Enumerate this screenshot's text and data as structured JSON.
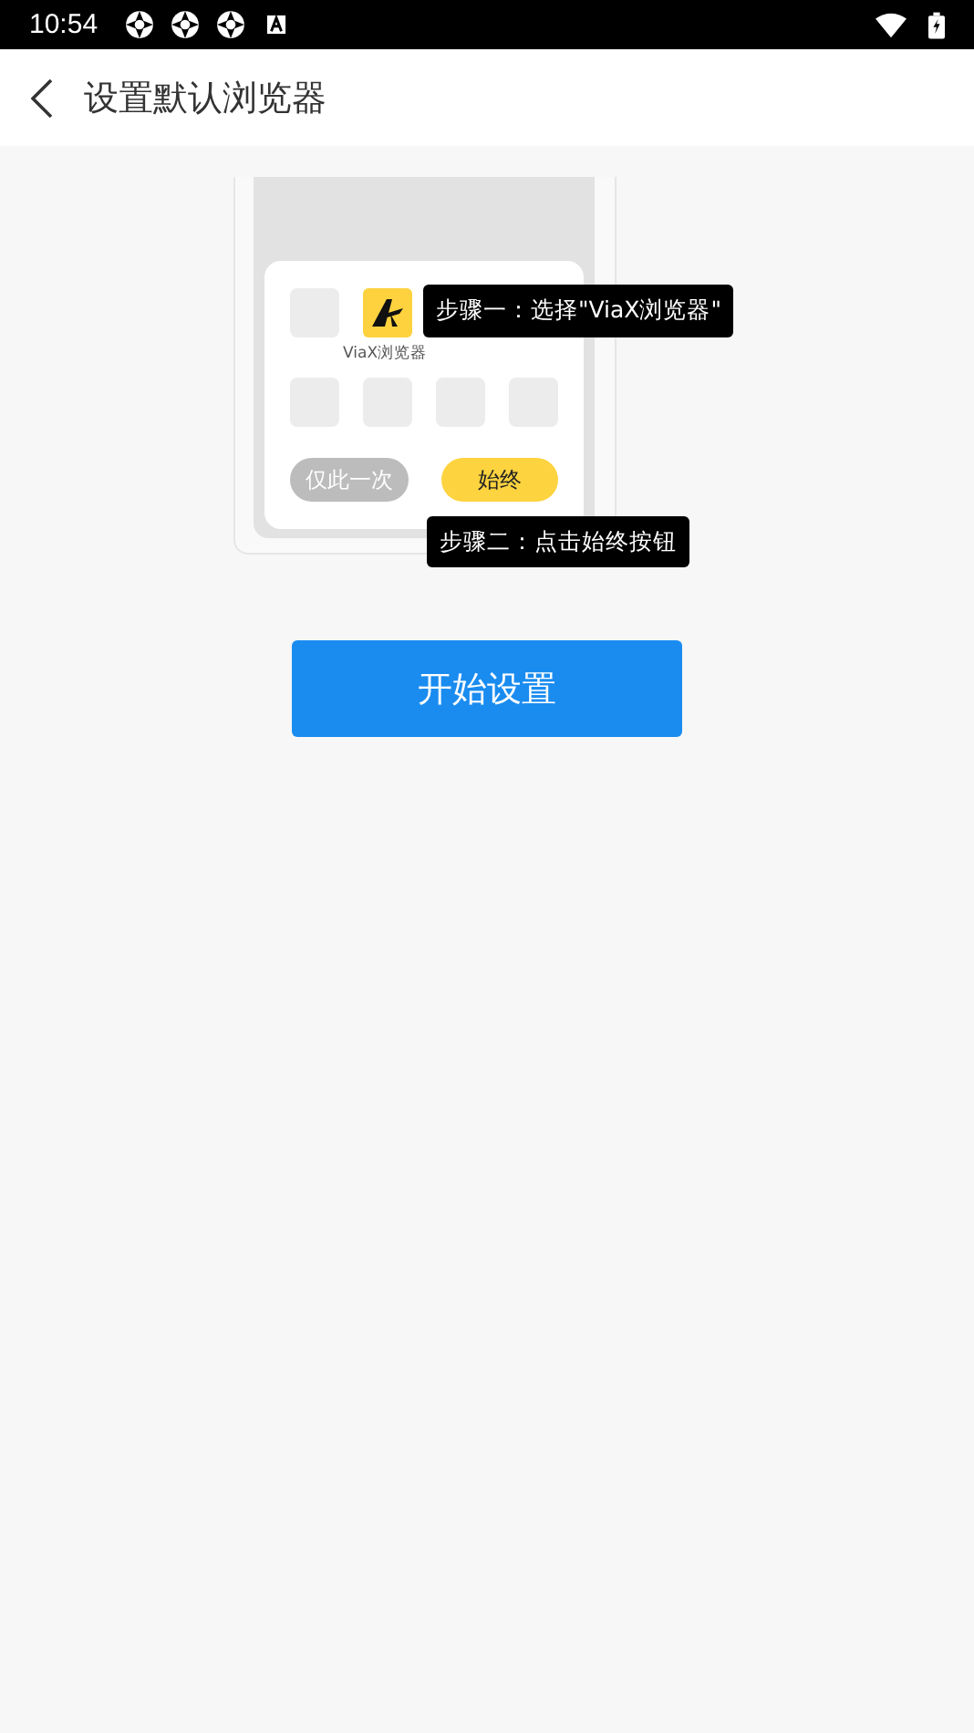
{
  "status_bar": {
    "time": "10:54"
  },
  "header": {
    "title": "设置默认浏览器"
  },
  "illustration": {
    "app_label": "ViaX浏览器",
    "once_button": "仅此一次",
    "always_button": "始终",
    "step_1": "步骤一：选择\"ViaX浏览器\"",
    "step_2": "步骤二：点击始终按钮"
  },
  "start_button": "开始设置"
}
